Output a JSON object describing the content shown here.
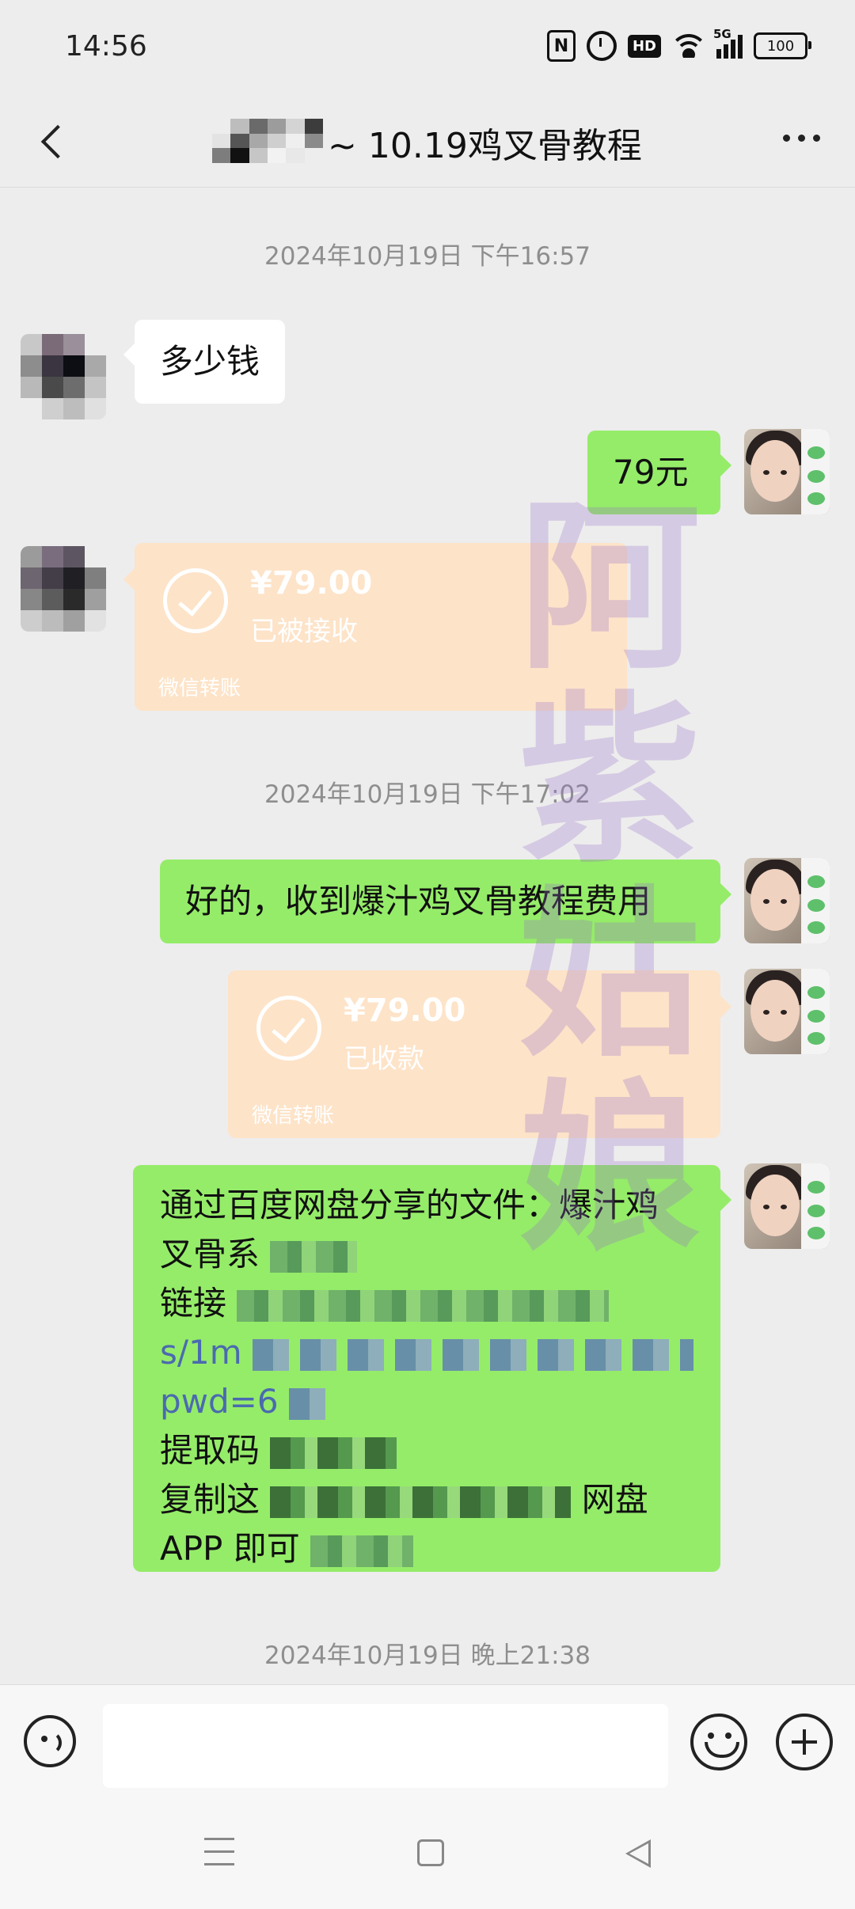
{
  "status_bar": {
    "time": "14:56",
    "network": "5G",
    "battery": "100"
  },
  "header": {
    "title": "~ 10.19鸡叉骨教程"
  },
  "messages": {
    "ts1": "2024年10月19日 下午16:57",
    "m1": "多少钱",
    "m2": "79元",
    "transfer1": {
      "amount": "¥79.00",
      "status": "已被接收",
      "footer": "微信转账"
    },
    "ts2": "2024年10月19日 下午17:02",
    "m3": "好的，收到爆汁鸡叉骨教程费用",
    "transfer2": {
      "amount": "¥79.00",
      "status": "已收款",
      "footer": "微信转账"
    },
    "share": {
      "line1": "通过百度网盘分享的文件：爆汁鸡",
      "line2": "叉骨系",
      "line3": "链接",
      "line4": "s/1m",
      "line5": "pwd=6",
      "line6": "提取码",
      "line7a": "复制这",
      "line7b": "网盘",
      "line8": "APP 即可"
    },
    "ts3": "2024年10月19日 晚上21:38"
  },
  "watermark": "阿紫姑娘",
  "colors": {
    "sent_bubble": "#95ec69",
    "transfer_card": "#fde3c8",
    "background": "#ededed"
  }
}
